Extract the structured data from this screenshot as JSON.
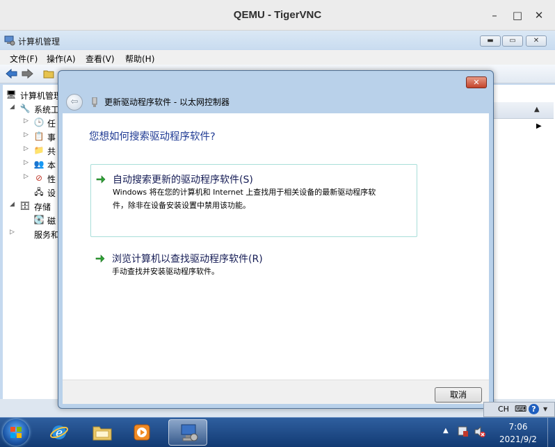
{
  "vnc": {
    "title": "QEMU - TigerVNC",
    "minimize": "–",
    "maximize": "□",
    "close": "✕"
  },
  "mmc": {
    "title": "计算机管理",
    "menu": [
      "文件(F)",
      "操作(A)",
      "查看(V)",
      "帮助(H)"
    ],
    "tree": [
      {
        "label": "计算机管理",
        "icon": "computer-management-icon"
      },
      {
        "label": "系统工",
        "icon": "tools-icon"
      },
      {
        "label": "任",
        "icon": "clock-icon"
      },
      {
        "label": "事",
        "icon": "event-viewer-icon"
      },
      {
        "label": "共",
        "icon": "shared-folders-icon"
      },
      {
        "label": "本",
        "icon": "users-icon"
      },
      {
        "label": "性",
        "icon": "performance-icon"
      },
      {
        "label": "设",
        "icon": "device-manager-icon"
      },
      {
        "label": "存储",
        "icon": "storage-icon"
      },
      {
        "label": "磁",
        "icon": "disk-icon"
      },
      {
        "label": "服务和",
        "icon": "services-icon"
      }
    ]
  },
  "dialog": {
    "title": "更新驱动程序软件 - 以太网控制器",
    "heading": "您想如何搜索驱动程序软件?",
    "option1": {
      "title": "自动搜索更新的驱动程序软件(S)",
      "desc_line1": "Windows 将在您的计算机和 Internet 上查找用于相关设备的最新驱动程序软",
      "desc_line2": "件，除非在设备安装设置中禁用该功能。"
    },
    "option2": {
      "title": "浏览计算机以查找驱动程序软件(R)",
      "desc": "手动查找并安装驱动程序软件。"
    },
    "cancel": "取消",
    "close": "✕"
  },
  "taskbar": {
    "lang": "CH",
    "time": "7:06",
    "date": "2021/9/2"
  }
}
